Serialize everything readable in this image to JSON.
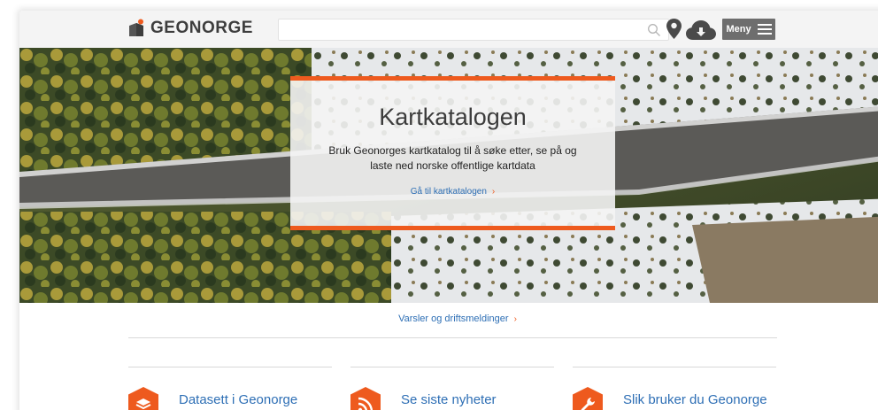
{
  "header": {
    "logo_text": "GEONORGE",
    "search_value": "",
    "search_placeholder": "",
    "menu_label": "Meny",
    "icons": [
      "search-icon",
      "map-pin-icon",
      "download-cloud-icon",
      "hamburger-icon"
    ]
  },
  "hero": {
    "title": "Kartkatalogen",
    "description": "Bruk Geonorges kartkatalog til å søke etter, se på og laste ned norske offentlige kartdata",
    "link_label": "Gå til kartkatalogen",
    "link_chevron": "›"
  },
  "notices": {
    "link_label": "Varsler og driftsmeldinger",
    "link_chevron": "›"
  },
  "features": [
    {
      "title": "Datasett i Geonorge",
      "icon": "layers-icon"
    },
    {
      "title": "Se siste nyheter",
      "icon": "rss-icon"
    },
    {
      "title": "Slik bruker du Geonorge",
      "icon": "wrench-icon"
    }
  ],
  "colors": {
    "accent": "#ee5a1e",
    "link": "#2e6fb5",
    "header_bg": "#f4f4f4",
    "menu_bg": "#6e6e6e"
  }
}
